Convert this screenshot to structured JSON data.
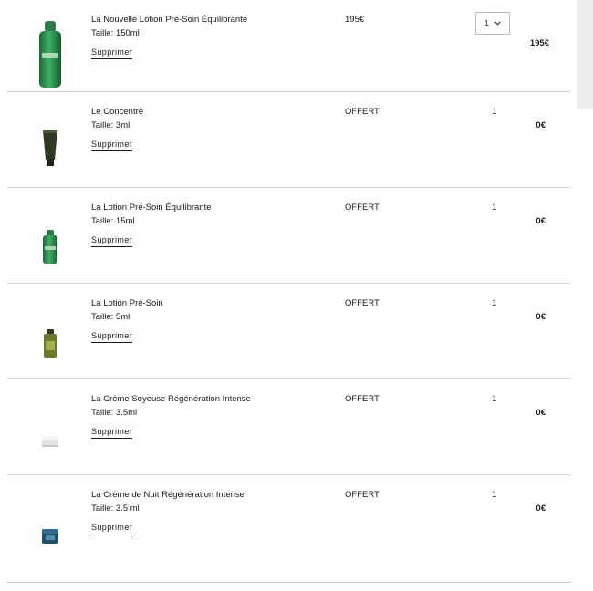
{
  "cart": {
    "remove_label": "Supprimer",
    "items": [
      {
        "name": "La Nouvelle Lotion Pré-Soin Équilibrante",
        "size": "Taille: 150ml",
        "unit_price": "195€",
        "quantity": "1",
        "line_total": "195€",
        "image": "green-lotion-bottle-large"
      },
      {
        "name": "Le Concentré",
        "size": "Taille: 3ml",
        "unit_price": "OFFERT",
        "quantity": "1",
        "line_total": "0€",
        "image": "dark-green-tube"
      },
      {
        "name": "La Lotion Pré-Soin Équilibrante",
        "size": "Taille: 15ml",
        "unit_price": "OFFERT",
        "quantity": "1",
        "line_total": "0€",
        "image": "green-lotion-bottle-small"
      },
      {
        "name": "La Lotion Pré-Soin",
        "size": "Taille: 5ml",
        "unit_price": "OFFERT",
        "quantity": "1",
        "line_total": "0€",
        "image": "olive-lotion-bottle-mini"
      },
      {
        "name": "La Crème Soyeuse Régénération Intense",
        "size": "Taille: 3.5ml",
        "unit_price": "OFFERT",
        "quantity": "1",
        "line_total": "0€",
        "image": "white-cream-jar"
      },
      {
        "name": "La Crème de Nuit Régénération Intense",
        "size": "Taille: 3.5 ml",
        "unit_price": "OFFERT",
        "quantity": "1",
        "line_total": "0€",
        "image": "blue-cream-jar"
      }
    ]
  },
  "colors": {
    "text": "#1a1a1a",
    "divider": "#d6d6d6",
    "bottle_green": "#2d8a4e",
    "tube_green": "#2f3a22",
    "night_blue": "#1f4f6b"
  }
}
